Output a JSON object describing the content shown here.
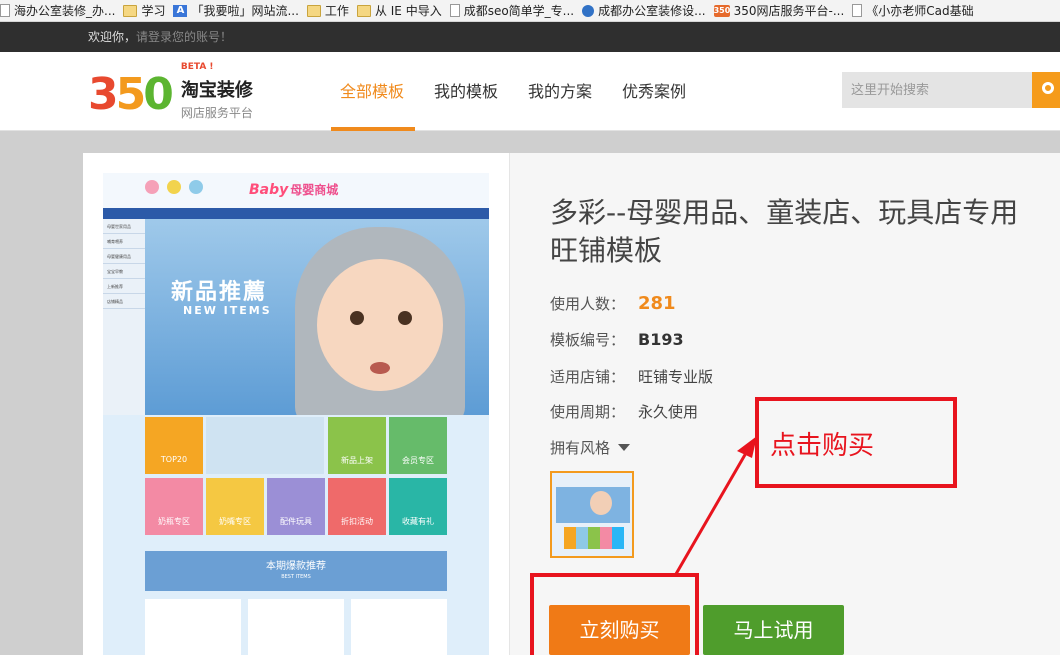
{
  "bookmarks": [
    {
      "icon": "page-icon",
      "label": "海办公室装修_办..."
    },
    {
      "icon": "folder-icon",
      "label": "学习"
    },
    {
      "icon": "app-icon",
      "label": "「我要啦」网站流..."
    },
    {
      "icon": "folder-icon",
      "label": "工作"
    },
    {
      "icon": "folder-icon",
      "label": "从 IE 中导入"
    },
    {
      "icon": "page-icon",
      "label": "成都seo简单学_专..."
    },
    {
      "icon": "site-icon",
      "label": "成都办公室装修设..."
    },
    {
      "icon": "brand-icon",
      "label": "350网店服务平台-..."
    },
    {
      "icon": "page-icon",
      "label": "《小亦老师Cad基础"
    }
  ],
  "topbar": {
    "welcome": "欢迎你，",
    "login_hint": "请登录您的账号！"
  },
  "logo": {
    "digits": [
      "3",
      "5",
      "0"
    ],
    "beta": "BETA !",
    "name": "淘宝装修",
    "subtitle": "网店服务平台"
  },
  "nav": {
    "items": [
      "全部模板",
      "我的模板",
      "我的方案",
      "优秀案例"
    ],
    "active_index": 0
  },
  "search": {
    "placeholder": "这里开始搜索"
  },
  "preview": {
    "brand_en": "Baby",
    "brand_cn": "母婴商城",
    "banner_title": "新品推薦",
    "banner_sub": "NEW ITEMS",
    "side_items": [
      "母婴世家用品",
      "哺育喂养",
      "母婴健康用品",
      "宝宝早教",
      "上新推荐",
      "店铺精品"
    ],
    "tiles": [
      "TOP20",
      "新品上架",
      "会员专区",
      "奶瓶专区",
      "奶嘴专区",
      "配件玩具",
      "折扣活动",
      "收藏有礼"
    ],
    "best_title": "本期爆款推荐",
    "best_sub": "BEST ITEMS"
  },
  "detail": {
    "title": "多彩--母婴用品、童装店、玩具店专用旺铺模板",
    "users_label": "使用人数：",
    "users_value": "281",
    "code_label": "模板编号：",
    "code_value": "B193",
    "store_label": "适用店铺：",
    "store_value": "旺铺专业版",
    "period_label": "使用周期：",
    "period_value": "永久使用",
    "styles_label": "拥有风格"
  },
  "buttons": {
    "buy": "立刻购买",
    "try": "马上试用"
  },
  "annotation": {
    "label": "点击购买",
    "color": "#e8141e"
  },
  "colors": {
    "accent": "#f08a1c",
    "buy": "#f07a16",
    "try": "#4f9d2c",
    "topbar": "#2f2f2f"
  }
}
